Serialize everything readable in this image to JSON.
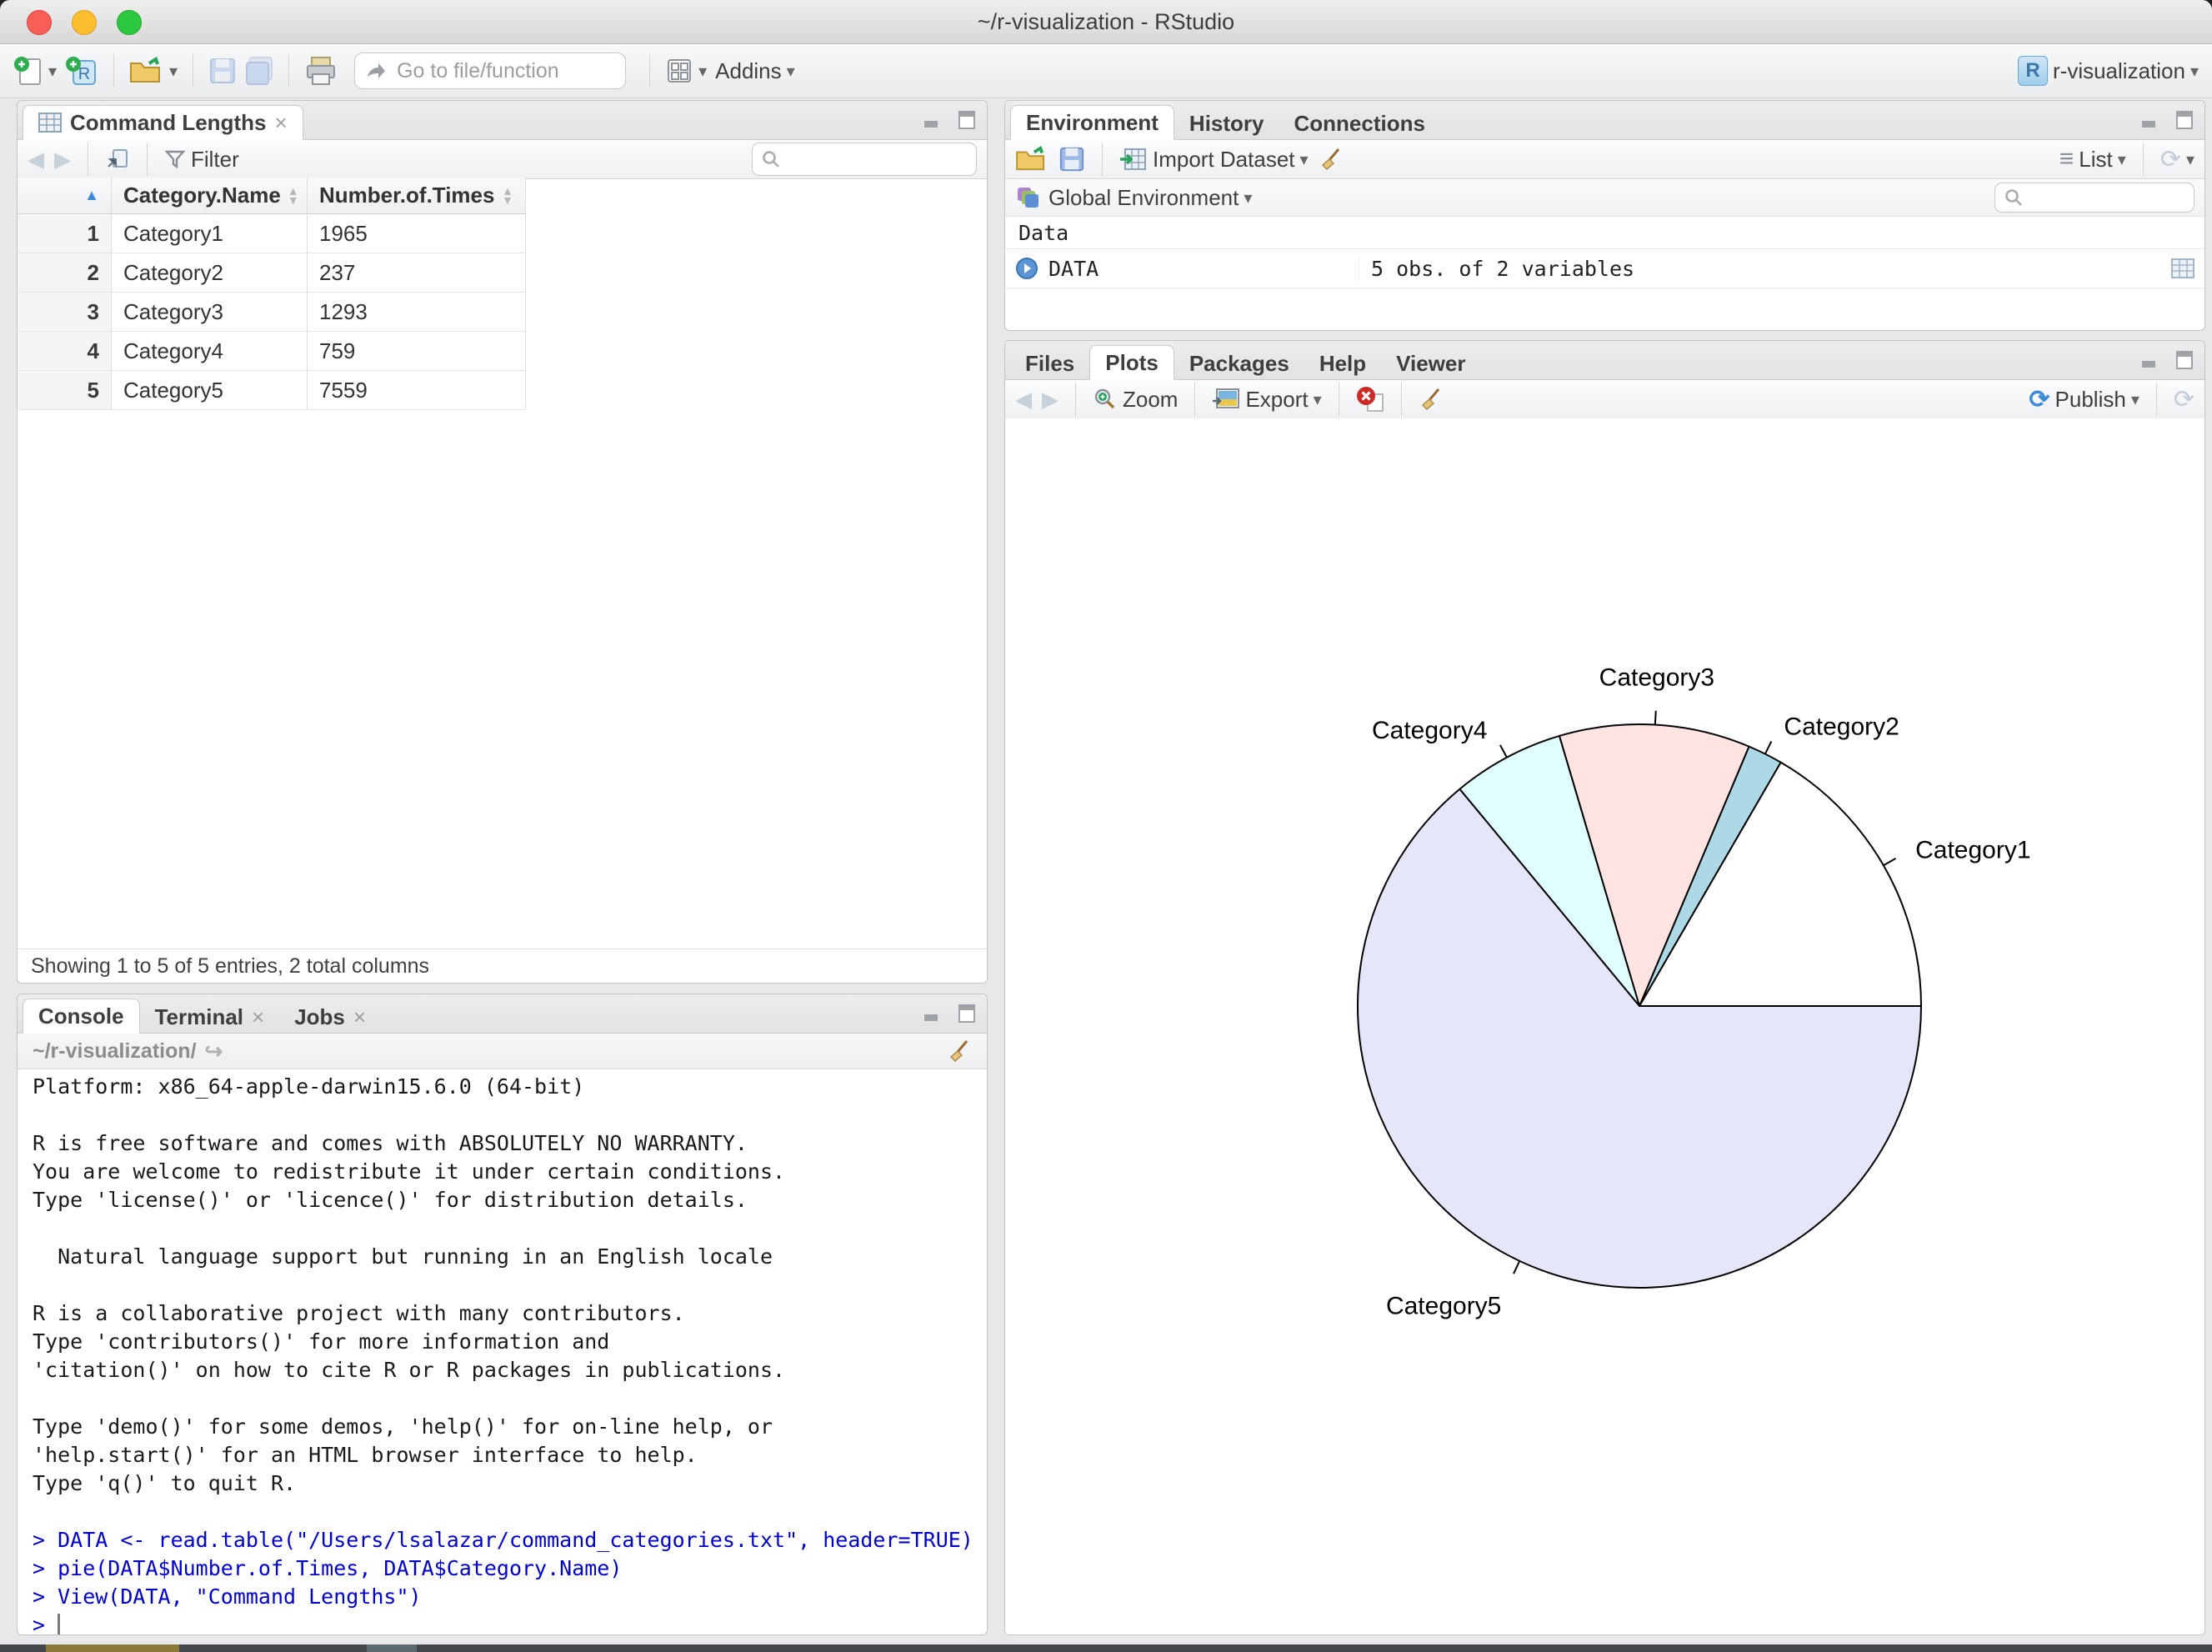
{
  "window": {
    "title": "~/r-visualization - RStudio",
    "traffic_lights": {
      "close": "#f95f57",
      "minimize": "#fbbe2e",
      "maximize": "#2bc840"
    }
  },
  "toolbar": {
    "goto_placeholder": "Go to file/function",
    "addins_label": "Addins",
    "project_label": "r-visualization"
  },
  "viewer_pane": {
    "tab_label": "Command Lengths",
    "filter_label": "Filter",
    "status": "Showing 1 to 5 of 5 entries, 2 total columns",
    "table": {
      "columns": [
        "Category.Name",
        "Number.of.Times"
      ],
      "rows": [
        {
          "n": "1",
          "name": "Category1",
          "times": "1965"
        },
        {
          "n": "2",
          "name": "Category2",
          "times": "237"
        },
        {
          "n": "3",
          "name": "Category3",
          "times": "1293"
        },
        {
          "n": "4",
          "name": "Category4",
          "times": "759"
        },
        {
          "n": "5",
          "name": "Category5",
          "times": "7559"
        }
      ]
    }
  },
  "environment_pane": {
    "tabs": [
      "Environment",
      "History",
      "Connections"
    ],
    "import_label": "Import Dataset",
    "list_label": "List",
    "scope_label": "Global Environment",
    "section_label": "Data",
    "objects": [
      {
        "name": "DATA",
        "desc": "5 obs. of 2 variables"
      }
    ]
  },
  "plots_pane": {
    "tabs": [
      "Files",
      "Plots",
      "Packages",
      "Help",
      "Viewer"
    ],
    "active_tab": "Plots",
    "zoom_label": "Zoom",
    "export_label": "Export",
    "publish_label": "Publish"
  },
  "console_pane": {
    "tabs": [
      "Console",
      "Terminal",
      "Jobs"
    ],
    "working_dir": "~/r-visualization/",
    "prompt": "> ",
    "lines": [
      {
        "type": "output",
        "text": "Platform: x86_64-apple-darwin15.6.0 (64-bit)"
      },
      {
        "type": "blank",
        "text": ""
      },
      {
        "type": "output",
        "text": "R is free software and comes with ABSOLUTELY NO WARRANTY."
      },
      {
        "type": "output",
        "text": "You are welcome to redistribute it under certain conditions."
      },
      {
        "type": "output",
        "text": "Type 'license()' or 'licence()' for distribution details."
      },
      {
        "type": "blank",
        "text": ""
      },
      {
        "type": "output",
        "text": "  Natural language support but running in an English locale"
      },
      {
        "type": "blank",
        "text": ""
      },
      {
        "type": "output",
        "text": "R is a collaborative project with many contributors."
      },
      {
        "type": "output",
        "text": "Type 'contributors()' for more information and"
      },
      {
        "type": "output",
        "text": "'citation()' on how to cite R or R packages in publications."
      },
      {
        "type": "blank",
        "text": ""
      },
      {
        "type": "output",
        "text": "Type 'demo()' for some demos, 'help()' for on-line help, or"
      },
      {
        "type": "output",
        "text": "'help.start()' for an HTML browser interface to help."
      },
      {
        "type": "output",
        "text": "Type 'q()' to quit R."
      },
      {
        "type": "blank",
        "text": ""
      },
      {
        "type": "input",
        "text": "> DATA <- read.table(\"/Users/lsalazar/command_categories.txt\", header=TRUE)"
      },
      {
        "type": "input",
        "text": "> pie(DATA$Number.of.Times, DATA$Category.Name)"
      },
      {
        "type": "input",
        "text": "> View(DATA, \"Command Lengths\")"
      }
    ]
  },
  "chart_data": {
    "type": "pie",
    "title": "",
    "categories": [
      "Category1",
      "Category2",
      "Category3",
      "Category4",
      "Category5"
    ],
    "values": [
      1965,
      237,
      1293,
      759,
      7559
    ],
    "colors": [
      "#FFFFFF",
      "#ADD8E6",
      "#FFE4E1",
      "#E0FFFF",
      "#E6E6FA"
    ],
    "start_angle_deg": 0,
    "direction": "counterclockwise",
    "legend": "none"
  }
}
